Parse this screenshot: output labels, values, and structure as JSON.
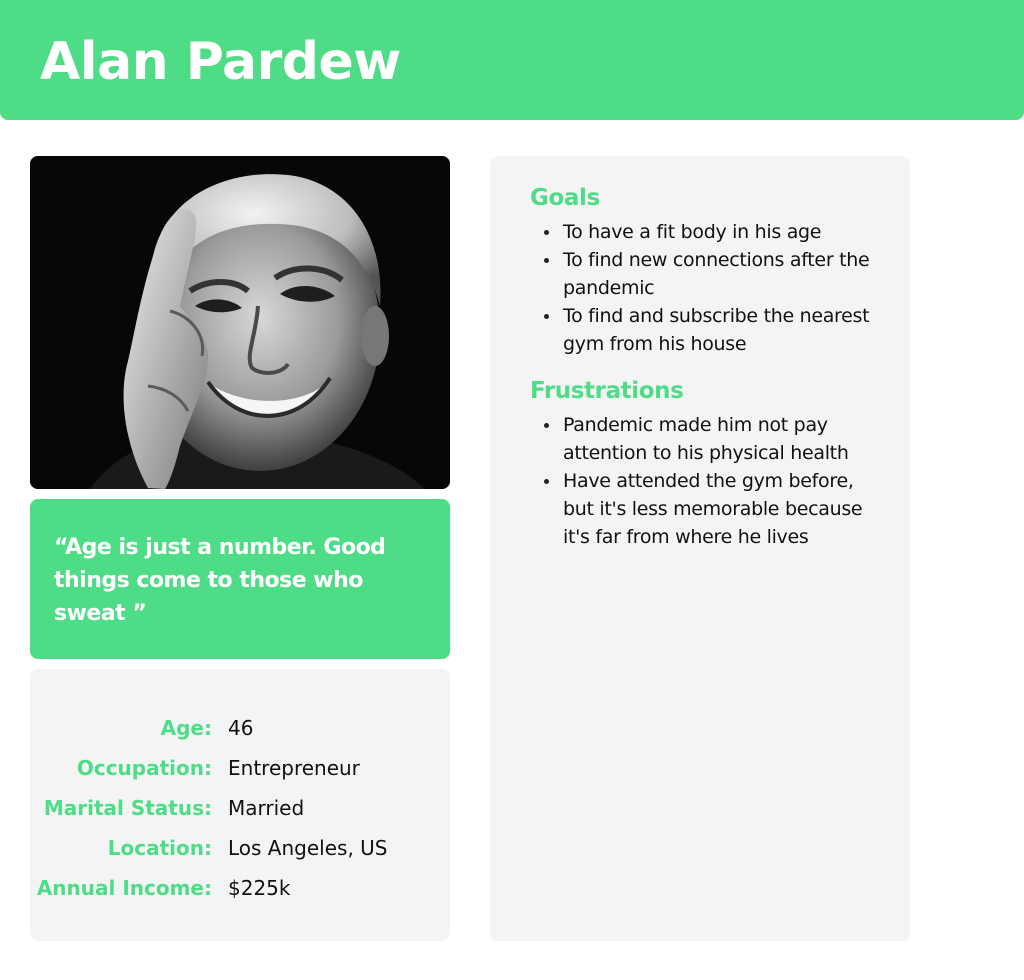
{
  "persona": {
    "name": "Alan Pardew",
    "quote": "“Age is just a number. Good things come to those who sweat ”"
  },
  "colors": {
    "accent": "#4fdc87",
    "card_background": "#f4f4f4",
    "text": "#111111"
  },
  "photo": {
    "icon": "portrait-photo"
  },
  "info": [
    {
      "label": "Age:",
      "value": "46"
    },
    {
      "label": "Occupation:",
      "value": "Entrepreneur"
    },
    {
      "label": "Marital Status:",
      "value": "Married"
    },
    {
      "label": "Location:",
      "value": "Los Angeles, US"
    },
    {
      "label": "Annual Income:",
      "value": "$225k"
    }
  ],
  "goals": {
    "title": "Goals",
    "items": [
      "To have a fit body in his age",
      "To find new connections after the pandemic",
      "To find and subscribe the nearest gym from his house"
    ]
  },
  "frustrations": {
    "title": "Frustrations",
    "items": [
      "Pandemic made him not pay attention to his physical health",
      "Have attended the gym before, but it's less memorable because it's far from where he lives"
    ]
  }
}
